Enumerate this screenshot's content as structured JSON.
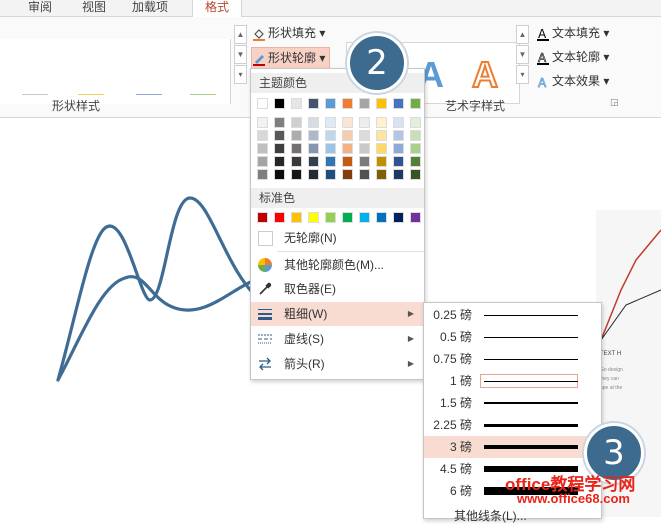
{
  "tabs": {
    "review": "审阅",
    "view": "视图",
    "addins": "加载项",
    "format": "格式"
  },
  "ribbon": {
    "shape_fill": "形状填充",
    "shape_outline": "形状轮廓",
    "shape_styles_label": "形状样式",
    "wordart_label": "艺术字样式",
    "text_fill": "文本填充",
    "text_outline": "文本轮廓",
    "text_effect": "文本效果",
    "wordart_letter": "A",
    "gallery_line_colors": [
      "#c8c8c8",
      "#f2d15a",
      "#8da9d6",
      "#a9d18e"
    ]
  },
  "menu": {
    "theme_colors_label": "主题颜色",
    "theme_top_row": [
      "#ffffff",
      "#000000",
      "#e7e6e6",
      "#44546a",
      "#5b9bd5",
      "#ed7d31",
      "#a5a5a5",
      "#ffc000",
      "#4472c4",
      "#70ad47"
    ],
    "theme_shades": [
      [
        "#f2f2f2",
        "#7f7f7f",
        "#d0cece",
        "#d6dce4",
        "#deebf6",
        "#fbe5d5",
        "#ededed",
        "#fff2cc",
        "#d9e2f3",
        "#e2efd9"
      ],
      [
        "#d8d8d8",
        "#595959",
        "#aeabab",
        "#adb9ca",
        "#bdd7ee",
        "#f8cbad",
        "#dbdbdb",
        "#fee599",
        "#b4c6e7",
        "#c5e0b3"
      ],
      [
        "#bfbfbf",
        "#3f3f3f",
        "#757070",
        "#8496b0",
        "#9dc3e6",
        "#f4b183",
        "#c9c9c9",
        "#ffd965",
        "#8eaadb",
        "#a8d08d"
      ],
      [
        "#a5a5a5",
        "#262626",
        "#3a3838",
        "#323f4f",
        "#2e75b5",
        "#c55a11",
        "#7b7b7b",
        "#bf9000",
        "#2f5496",
        "#538135"
      ],
      [
        "#7f7f7f",
        "#0c0c0c",
        "#171616",
        "#222a35",
        "#1e4e79",
        "#833c0b",
        "#525252",
        "#7f6000",
        "#1f3864",
        "#375623"
      ]
    ],
    "standard_colors_label": "标准色",
    "standard_colors": [
      "#c00000",
      "#ff0000",
      "#ffc000",
      "#ffff00",
      "#92d050",
      "#00b050",
      "#00b0f0",
      "#0070c0",
      "#002060",
      "#7030a0"
    ],
    "no_outline": "无轮廓(N)",
    "more_colors": "其他轮廓颜色(M)...",
    "eyedropper": "取色器(E)",
    "weight": "粗细(W)",
    "dashes": "虚线(S)",
    "arrows": "箭头(R)"
  },
  "weights": [
    {
      "label": "0.25 磅",
      "thickness": 0.25
    },
    {
      "label": "0.5 磅",
      "thickness": 0.5
    },
    {
      "label": "0.75 磅",
      "thickness": 0.75
    },
    {
      "label": "1 磅",
      "thickness": 1
    },
    {
      "label": "1.5 磅",
      "thickness": 1.5
    },
    {
      "label": "2.25 磅",
      "thickness": 2.25
    },
    {
      "label": "3 磅",
      "thickness": 3
    },
    {
      "label": "4.5 磅",
      "thickness": 4.5
    },
    {
      "label": "6 磅",
      "thickness": 6
    }
  ],
  "weights_selected": "1 磅",
  "weights_hovered": "3 磅",
  "sub_more_lines": "其他线条(L)...",
  "callouts": {
    "step2": "2",
    "step3": "3"
  },
  "thumb_text": {
    "heading": "TEXT H",
    "body1": "Go design",
    "body2": "they can",
    "body3": "ape at the"
  },
  "watermark": {
    "line1": "office教程学习网",
    "line2": "www.office68.com"
  },
  "accent": "#b7472a",
  "curve_color": "#3f6c95"
}
